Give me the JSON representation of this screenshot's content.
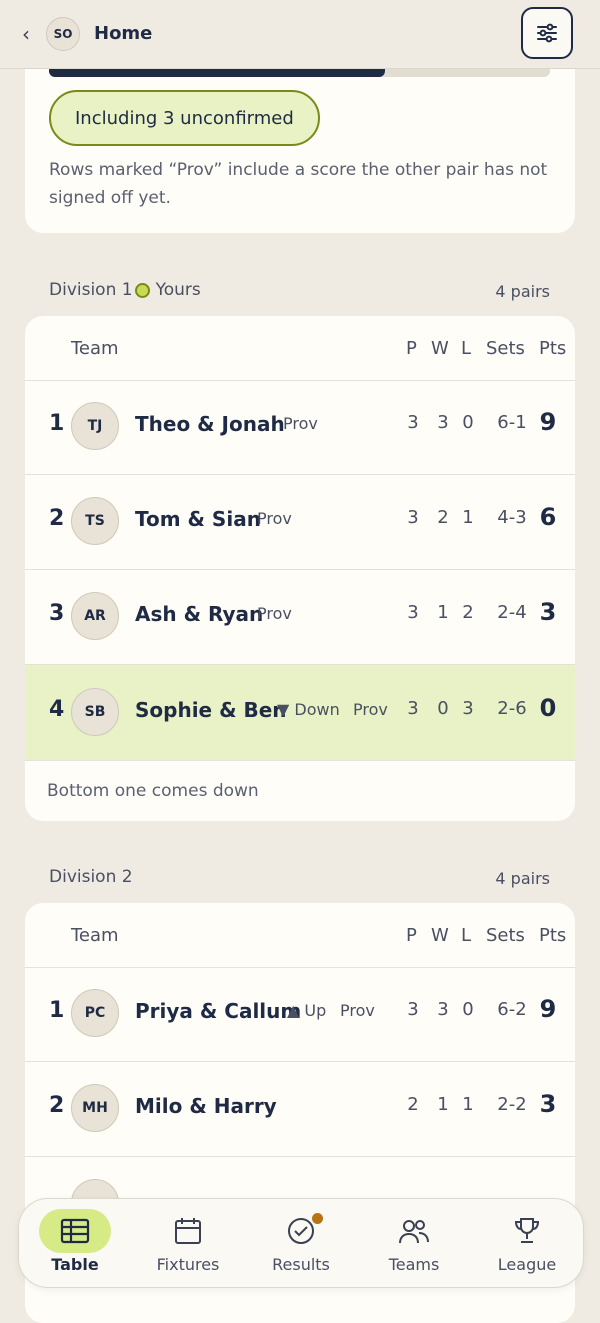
{
  "header": {
    "back_glyph": "‹",
    "avatar": "SO",
    "title": "Home",
    "filter_icon": "sliders-icon"
  },
  "summary": {
    "progress": 0.67,
    "pill": "Including 3 unconfirmed",
    "note": "Rows marked “Prov” include a score the other pair has not signed off yet."
  },
  "columns": {
    "team": "Team",
    "p": "P",
    "w": "W",
    "l": "L",
    "sets": "Sets",
    "pts": "Pts"
  },
  "division1": {
    "label": "Division 1",
    "yours": "Yours",
    "count": "4 pairs",
    "rows": [
      {
        "rank": "1",
        "initials": "TJ",
        "name": "Theo & Jonah",
        "move": "",
        "prov": "Prov",
        "p": "3",
        "w": "3",
        "l": "0",
        "sets": "6-1",
        "pts": "9"
      },
      {
        "rank": "2",
        "initials": "TS",
        "name": "Tom & Sian",
        "move": "",
        "prov": "Prov",
        "p": "3",
        "w": "2",
        "l": "1",
        "sets": "4-3",
        "pts": "6"
      },
      {
        "rank": "3",
        "initials": "AR",
        "name": "Ash & Ryan",
        "move": "",
        "prov": "Prov",
        "p": "3",
        "w": "1",
        "l": "2",
        "sets": "2-4",
        "pts": "3"
      },
      {
        "rank": "4",
        "initials": "SB",
        "name": "Sophie & Ben",
        "move": "▼ Down",
        "prov": "Prov",
        "p": "3",
        "w": "0",
        "l": "3",
        "sets": "2-6",
        "pts": "0"
      }
    ],
    "footer": "Bottom one comes down"
  },
  "division2": {
    "label": "Division 2",
    "count": "4 pairs",
    "rows": [
      {
        "rank": "1",
        "initials": "PC",
        "name": "Priya & Callum",
        "move": "▲ Up",
        "prov": "Prov",
        "p": "3",
        "w": "3",
        "l": "0",
        "sets": "6-2",
        "pts": "9"
      },
      {
        "rank": "2",
        "initials": "MH",
        "name": "Milo & Harry",
        "move": "",
        "prov": "",
        "p": "2",
        "w": "1",
        "l": "1",
        "sets": "2-2",
        "pts": "3"
      }
    ]
  },
  "nav": {
    "items": [
      {
        "label": "Table",
        "icon": "table-icon"
      },
      {
        "label": "Fixtures",
        "icon": "calendar-icon"
      },
      {
        "label": "Results",
        "icon": "check-circle-icon"
      },
      {
        "label": "Teams",
        "icon": "people-icon"
      },
      {
        "label": "League",
        "icon": "trophy-icon"
      }
    ]
  }
}
